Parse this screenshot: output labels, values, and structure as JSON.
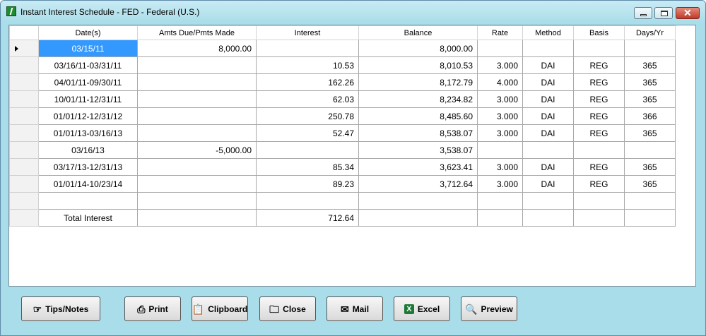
{
  "window": {
    "title": "Instant Interest Schedule - FED - Federal (U.S.)"
  },
  "grid": {
    "columns": [
      "Date(s)",
      "Amts Due/Pmts Made",
      "Interest",
      "Balance",
      "Rate",
      "Method",
      "Basis",
      "Days/Yr"
    ],
    "rows": [
      {
        "date": "03/15/11",
        "amount": "8,000.00",
        "interest": "",
        "balance": "8,000.00",
        "rate": "",
        "method": "",
        "basis": "",
        "days": ""
      },
      {
        "date": "03/16/11-03/31/11",
        "amount": "",
        "interest": "10.53",
        "balance": "8,010.53",
        "rate": "3.000",
        "method": "DAI",
        "basis": "REG",
        "days": "365"
      },
      {
        "date": "04/01/11-09/30/11",
        "amount": "",
        "interest": "162.26",
        "balance": "8,172.79",
        "rate": "4.000",
        "method": "DAI",
        "basis": "REG",
        "days": "365"
      },
      {
        "date": "10/01/11-12/31/11",
        "amount": "",
        "interest": "62.03",
        "balance": "8,234.82",
        "rate": "3.000",
        "method": "DAI",
        "basis": "REG",
        "days": "365"
      },
      {
        "date": "01/01/12-12/31/12",
        "amount": "",
        "interest": "250.78",
        "balance": "8,485.60",
        "rate": "3.000",
        "method": "DAI",
        "basis": "REG",
        "days": "366"
      },
      {
        "date": "01/01/13-03/16/13",
        "amount": "",
        "interest": "52.47",
        "balance": "8,538.07",
        "rate": "3.000",
        "method": "DAI",
        "basis": "REG",
        "days": "365"
      },
      {
        "date": "03/16/13",
        "amount": "-5,000.00",
        "interest": "",
        "balance": "3,538.07",
        "rate": "",
        "method": "",
        "basis": "",
        "days": ""
      },
      {
        "date": "03/17/13-12/31/13",
        "amount": "",
        "interest": "85.34",
        "balance": "3,623.41",
        "rate": "3.000",
        "method": "DAI",
        "basis": "REG",
        "days": "365"
      },
      {
        "date": "01/01/14-10/23/14",
        "amount": "",
        "interest": "89.23",
        "balance": "3,712.64",
        "rate": "3.000",
        "method": "DAI",
        "basis": "REG",
        "days": "365"
      },
      {
        "date": "",
        "amount": "",
        "interest": "",
        "balance": "",
        "rate": "",
        "method": "",
        "basis": "",
        "days": ""
      },
      {
        "date": "Total Interest",
        "amount": "",
        "interest": "712.64",
        "balance": "",
        "rate": "",
        "method": "",
        "basis": "",
        "days": ""
      }
    ]
  },
  "buttons": {
    "tips": {
      "label": "Tips/Notes",
      "icon": "pointing-hand-icon"
    },
    "print": {
      "label": "Print",
      "icon": "printer-icon"
    },
    "clipboard": {
      "label": "Clipboard",
      "icon": "clipboard-icon"
    },
    "close": {
      "label": "Close",
      "icon": "folder-icon"
    },
    "mail": {
      "label": "Mail",
      "icon": "envelope-icon"
    },
    "excel": {
      "label": "Excel",
      "icon": "excel-icon"
    },
    "preview": {
      "label": "Preview",
      "icon": "magnifier-icon"
    }
  },
  "colors": {
    "window_bg": "#a8dde9",
    "selection": "#3399ff",
    "excel_green": "#1d7a36"
  }
}
